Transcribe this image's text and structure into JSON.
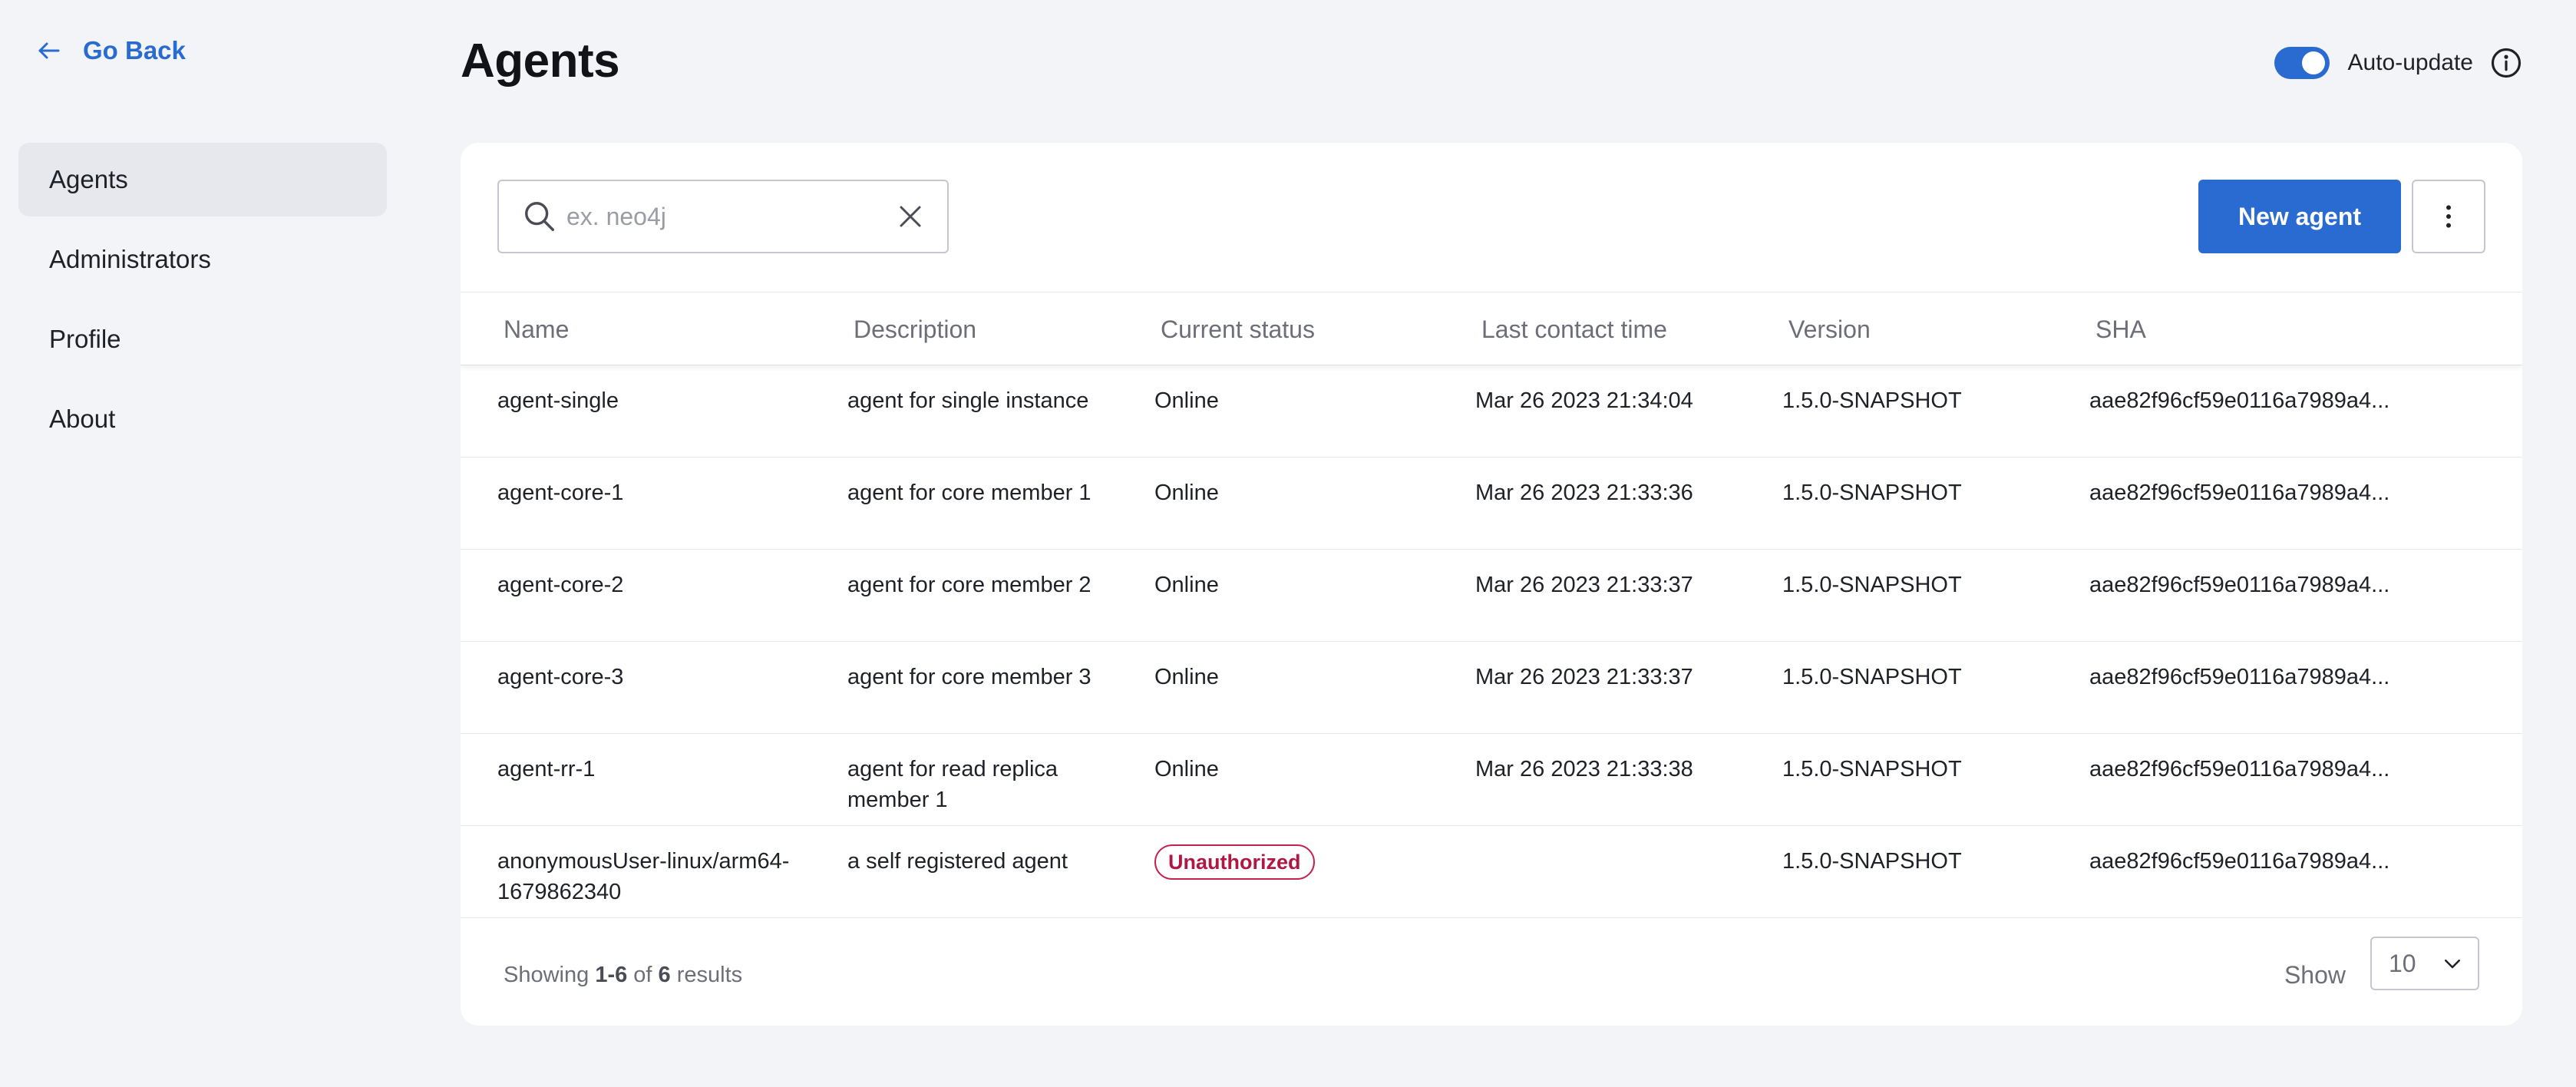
{
  "nav": {
    "go_back": "Go Back",
    "items": [
      {
        "label": "Agents",
        "active": true
      },
      {
        "label": "Administrators",
        "active": false
      },
      {
        "label": "Profile",
        "active": false
      },
      {
        "label": "About",
        "active": false
      }
    ]
  },
  "header": {
    "title": "Agents",
    "auto_update_label": "Auto-update",
    "auto_update_on": true
  },
  "toolbar": {
    "search_placeholder": "ex. neo4j",
    "search_value": "",
    "new_agent_label": "New agent"
  },
  "table": {
    "columns": [
      "Name",
      "Description",
      "Current status",
      "Last contact time",
      "Version",
      "SHA"
    ],
    "rows": [
      {
        "name": "agent-single",
        "description": "agent for single instance",
        "status": "Online",
        "last_contact": "Mar 26 2023 21:34:04",
        "version": "1.5.0-SNAPSHOT",
        "sha": "aae82f96cf59e0116a7989a4..."
      },
      {
        "name": "agent-core-1",
        "description": "agent for core member 1",
        "status": "Online",
        "last_contact": "Mar 26 2023 21:33:36",
        "version": "1.5.0-SNAPSHOT",
        "sha": "aae82f96cf59e0116a7989a4..."
      },
      {
        "name": "agent-core-2",
        "description": "agent for core member 2",
        "status": "Online",
        "last_contact": "Mar 26 2023 21:33:37",
        "version": "1.5.0-SNAPSHOT",
        "sha": "aae82f96cf59e0116a7989a4..."
      },
      {
        "name": "agent-core-3",
        "description": "agent for core member 3",
        "status": "Online",
        "last_contact": "Mar 26 2023 21:33:37",
        "version": "1.5.0-SNAPSHOT",
        "sha": "aae82f96cf59e0116a7989a4..."
      },
      {
        "name": "agent-rr-1",
        "description": "agent for read replica member 1",
        "status": "Online",
        "last_contact": "Mar 26 2023 21:33:38",
        "version": "1.5.0-SNAPSHOT",
        "sha": "aae82f96cf59e0116a7989a4..."
      },
      {
        "name": "anonymousUser-linux/arm64-1679862340",
        "description": "a self registered agent",
        "status": "Unauthorized",
        "last_contact": "",
        "version": "1.5.0-SNAPSHOT",
        "sha": "aae82f96cf59e0116a7989a4..."
      }
    ]
  },
  "footer": {
    "showing_prefix": "Showing",
    "range": "1-6",
    "of_label": "of",
    "total": "6",
    "results_label": "results",
    "show_label": "Show",
    "page_size": "10"
  },
  "colors": {
    "accent": "#2a6bd1",
    "background": "#f3f4f8",
    "unauthorized": "#b01743"
  },
  "icons": {
    "go_back": "arrow-left-icon",
    "info": "info-icon",
    "search": "search-icon",
    "clear": "close-icon",
    "more": "vertical-dots-icon",
    "page_size": "chevron-down-icon"
  }
}
